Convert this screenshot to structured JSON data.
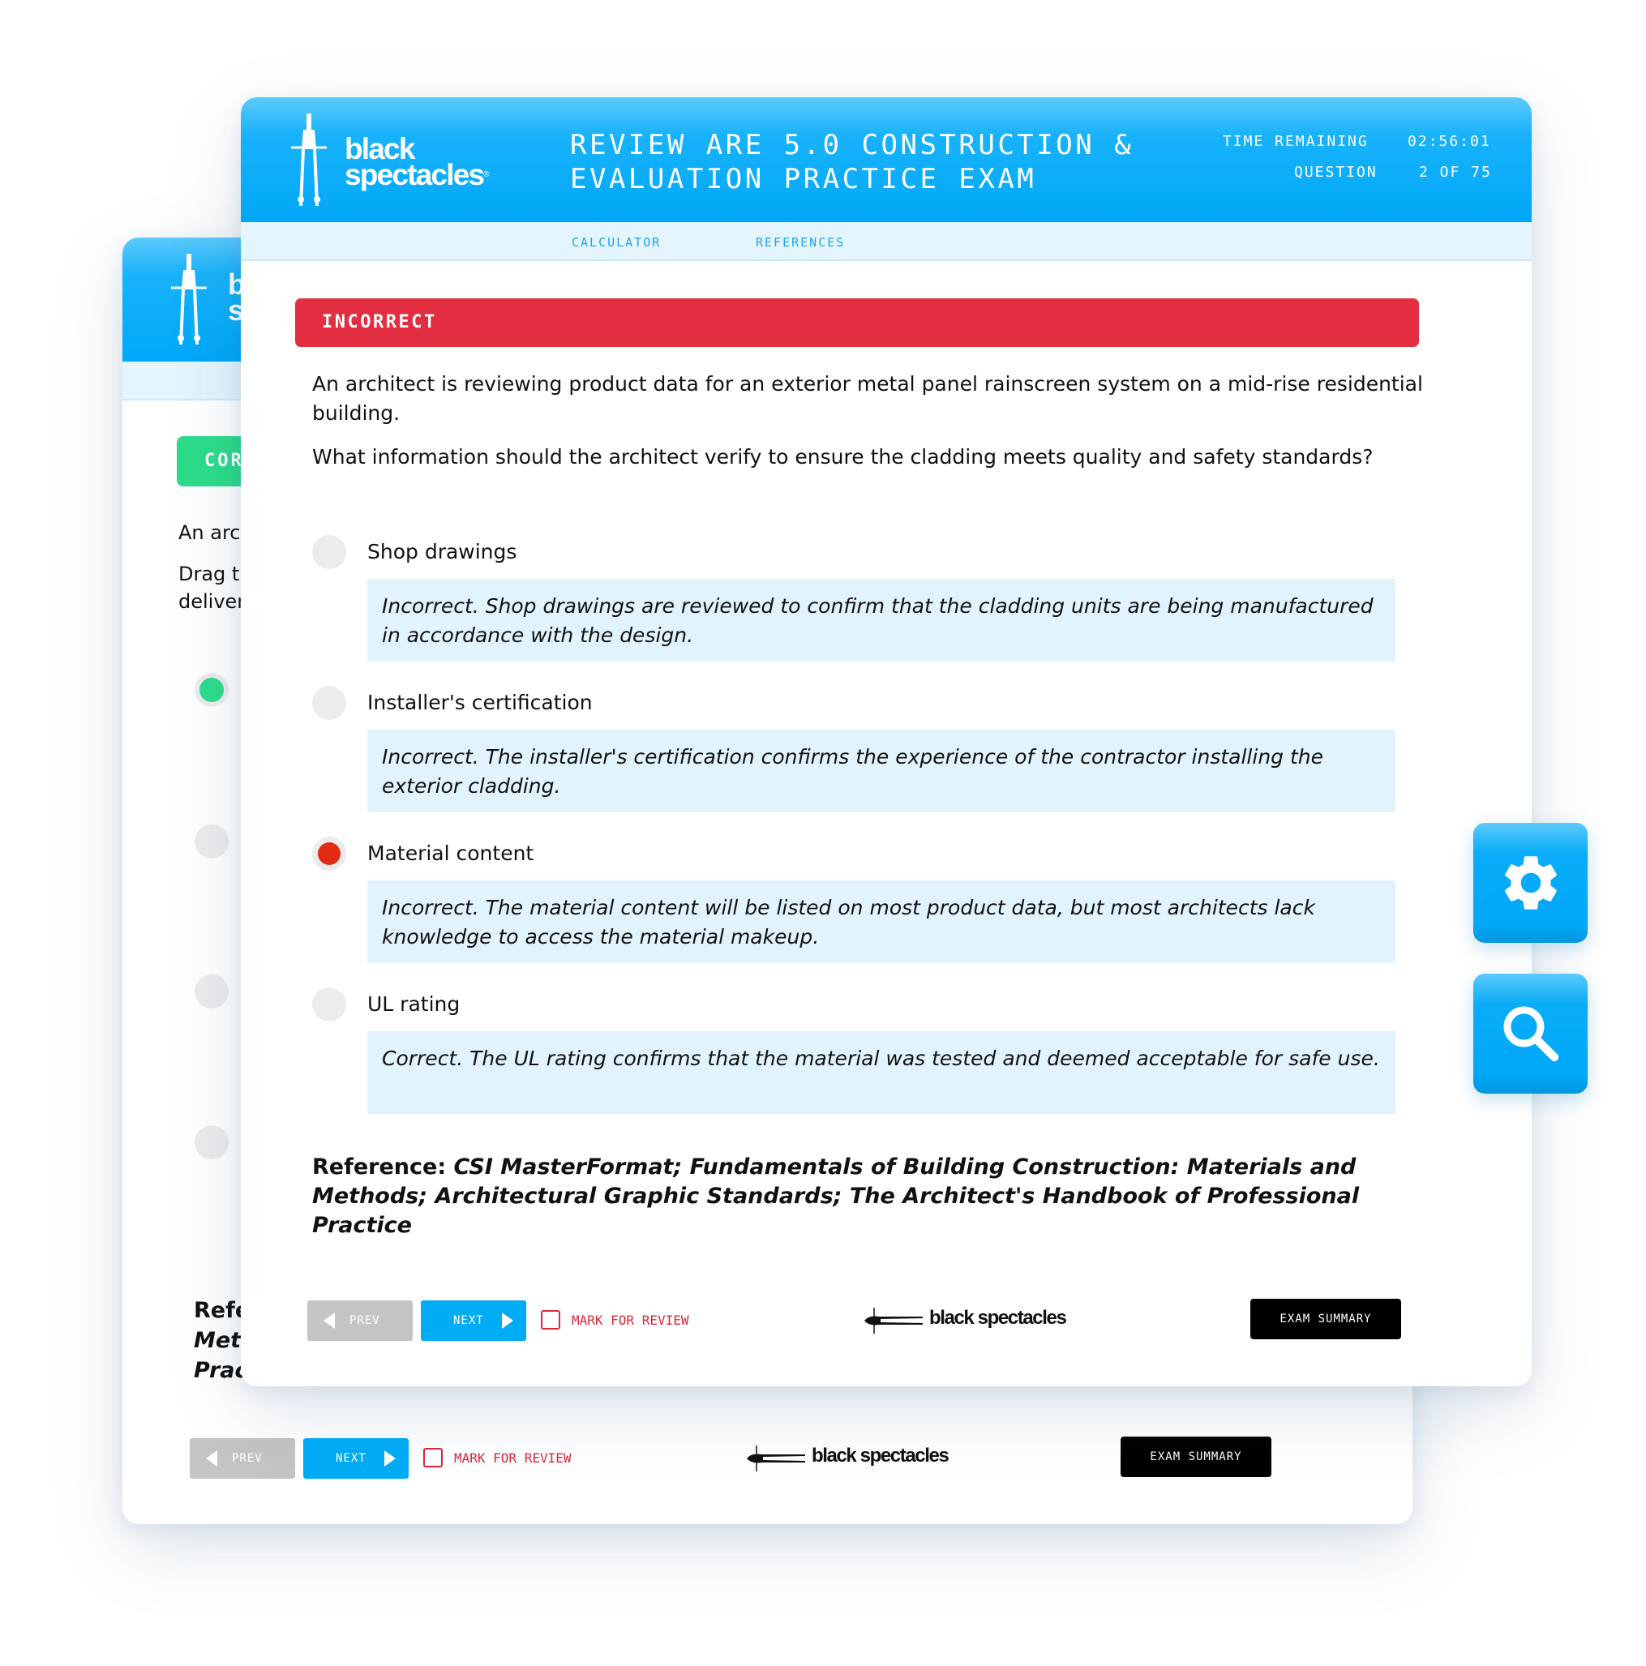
{
  "brand": {
    "name_line1": "black",
    "name_line2": "spectacles",
    "footer_name": "black spectacles",
    "colors": {
      "header_blue": "#00a8f8",
      "incorrect_red": "#e32d40",
      "correct_green": "#2ddc8a",
      "feedback_bg": "#e1f3fc",
      "selected_radio": "#e22b14"
    }
  },
  "background_window": {
    "status_banner": "CORRECT",
    "question_line": "An arc",
    "instruction_line1": "Drag t",
    "instruction_line2": "deliver",
    "reference_line1": "Refe",
    "reference_line2": "Met",
    "reference_line3": "Prac",
    "footer": {
      "prev_label": "PREV",
      "next_label": "NEXT",
      "mark_label": "MARK FOR REVIEW",
      "summary_label": "EXAM SUMMARY"
    }
  },
  "header": {
    "title_line1": "REVIEW ARE 5.0 CONSTRUCTION &",
    "title_line2": "EVALUATION PRACTICE EXAM",
    "time_label": "TIME REMAINING",
    "time_value": "02:56:01",
    "question_label": "QUESTION",
    "question_value": "2 OF 75"
  },
  "subnav": {
    "calculator": "CALCULATOR",
    "references": "REFERENCES"
  },
  "result_banner": "INCORRECT",
  "question": {
    "stem": "An architect is reviewing product data for an exterior metal panel rainscreen system on a mid-rise residential building.",
    "prompt": "What information should the architect verify to ensure the cladding meets quality and safety standards?"
  },
  "options": [
    {
      "label": "Shop drawings",
      "selected": false,
      "feedback": "Incorrect. Shop drawings are reviewed to confirm that the cladding units are being manufactured in accordance with the design."
    },
    {
      "label": "Installer's certification",
      "selected": false,
      "feedback": "Incorrect. The installer's certification confirms the experience of the contractor installing the exterior cladding."
    },
    {
      "label": "Material content",
      "selected": true,
      "feedback": "Incorrect. The material content will be listed on most product data, but most architects lack knowledge to access the material makeup."
    },
    {
      "label": "UL rating",
      "selected": false,
      "feedback": "Correct. The UL rating confirms that the material was tested and deemed acceptable for safe use."
    }
  ],
  "reference": {
    "label": "Reference:",
    "text": "CSI MasterFormat; Fundamentals of Building Construction: Materials and Methods; Architectural Graphic Standards; The Architect's Handbook of Professional Practice"
  },
  "footer": {
    "prev_label": "PREV",
    "next_label": "NEXT",
    "mark_label": "MARK FOR REVIEW",
    "summary_label": "EXAM SUMMARY"
  },
  "side_tools": [
    {
      "icon": "gear-icon",
      "name": "settings"
    },
    {
      "icon": "search-icon",
      "name": "search"
    }
  ]
}
